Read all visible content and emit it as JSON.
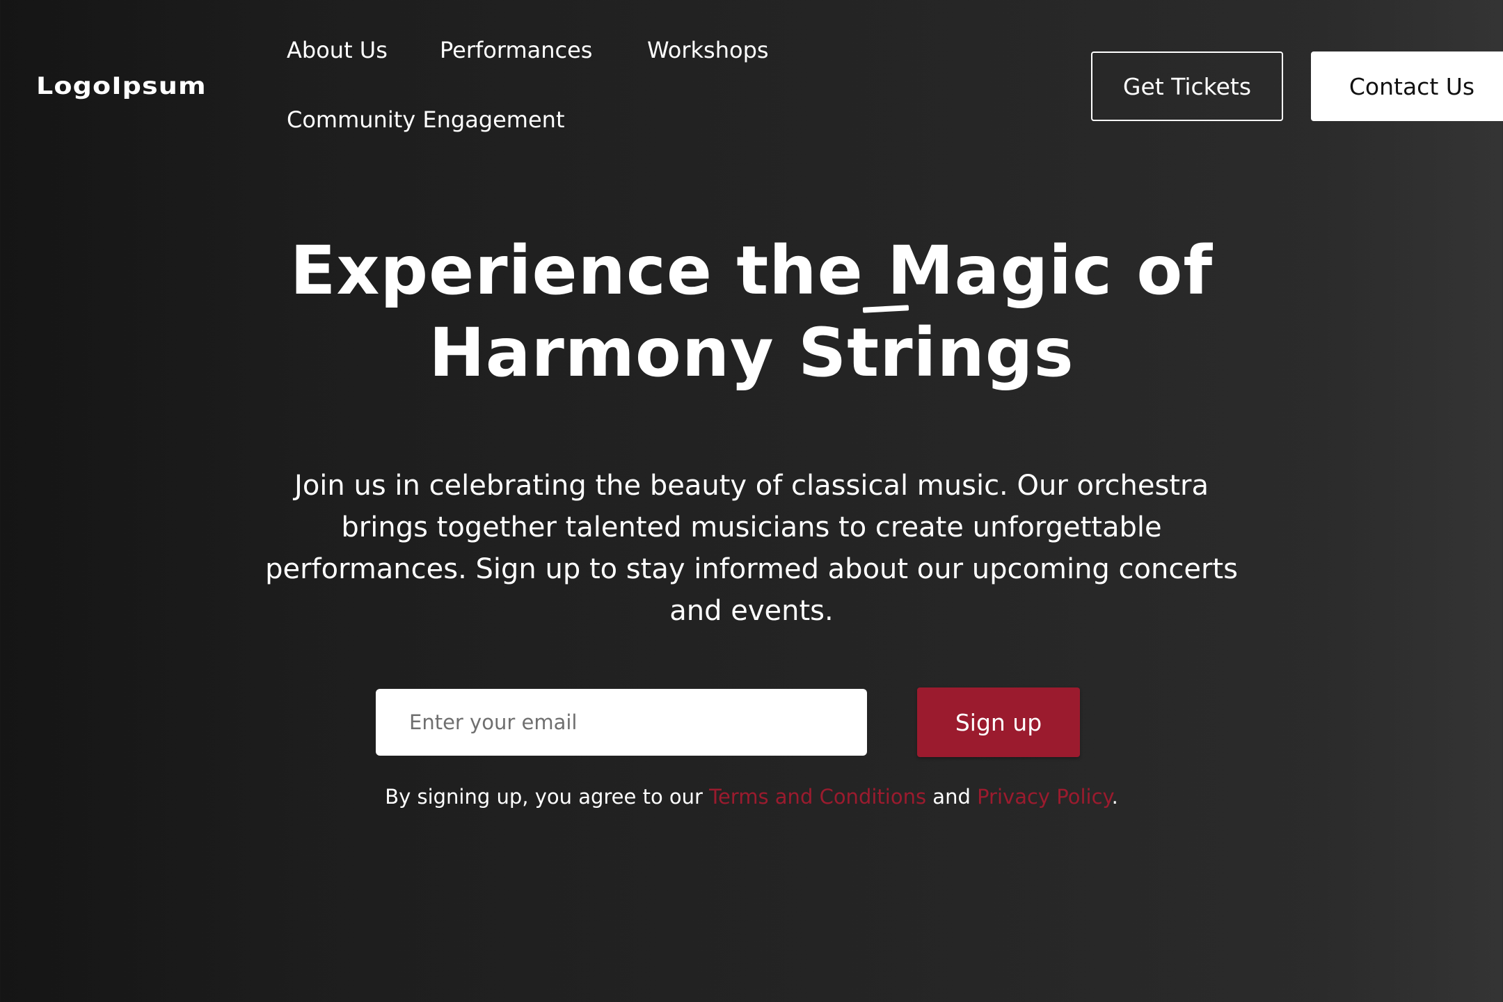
{
  "header": {
    "logo": "LogoIpsum",
    "nav": {
      "about": "About Us",
      "performances": "Performances",
      "workshops": "Workshops",
      "community": "Community Engagement"
    },
    "get_tickets": "Get Tickets",
    "contact_us": "Contact Us"
  },
  "hero": {
    "title_line1": "Experience the Magic of",
    "title_line2": "Harmony Strings",
    "description": "Join us in celebrating the beauty of classical music. Our orchestra brings together talented musicians to create unforgettable performances. Sign up to stay informed about our upcoming concerts and events."
  },
  "signup": {
    "email_placeholder": "Enter your email",
    "button_label": "Sign up",
    "legal_prefix": "By signing up, you agree to our ",
    "terms_label": "Terms and Conditions",
    "legal_and": " and ",
    "privacy_label": "Privacy Policy",
    "legal_suffix": "."
  },
  "colors": {
    "accent": "#9b1b2e",
    "background": "#222222",
    "text": "#ffffff"
  }
}
